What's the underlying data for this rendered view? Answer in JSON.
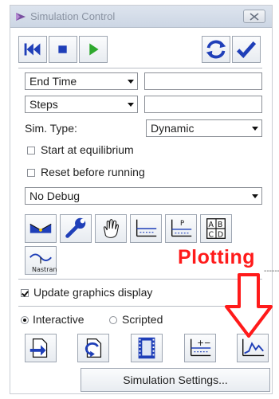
{
  "window": {
    "title": "Simulation Control",
    "close_glyph": "ꝏ"
  },
  "toolbar": {
    "rewind": "rewind-icon",
    "stop": "stop-icon",
    "play": "play-icon",
    "reload": "reload-icon",
    "apply": "check-icon",
    "accent_blue": "#1f3fb8",
    "play_green": "#2ea82e"
  },
  "form": {
    "end_time_label": "End Time",
    "end_time_value": "",
    "steps_label": "Steps",
    "steps_value": "",
    "sim_type_label": "Sim. Type:",
    "sim_type_value": "Dynamic",
    "start_equilibrium": "Start at equilibrium",
    "reset_before": "Reset before running",
    "debug_value": "No Debug"
  },
  "tools": {
    "row1": [
      "sensor-icon",
      "wrench-icon",
      "hand-icon",
      "graph-icon",
      "plot-points-icon",
      "abcd-table-icon"
    ],
    "nastran_label": "Nastran",
    "dotted_text": "------"
  },
  "options": {
    "update_graphics": "Update graphics display",
    "mode_interactive": "Interactive",
    "mode_scripted": "Scripted"
  },
  "bottom_tools": [
    "import-icon",
    "load-icon",
    "film-icon",
    "plot-tool-icon",
    "plotting-icon"
  ],
  "settings_button": "Simulation Settings...",
  "annotation": {
    "text": "Plotting",
    "color": "#ff1a1a"
  }
}
